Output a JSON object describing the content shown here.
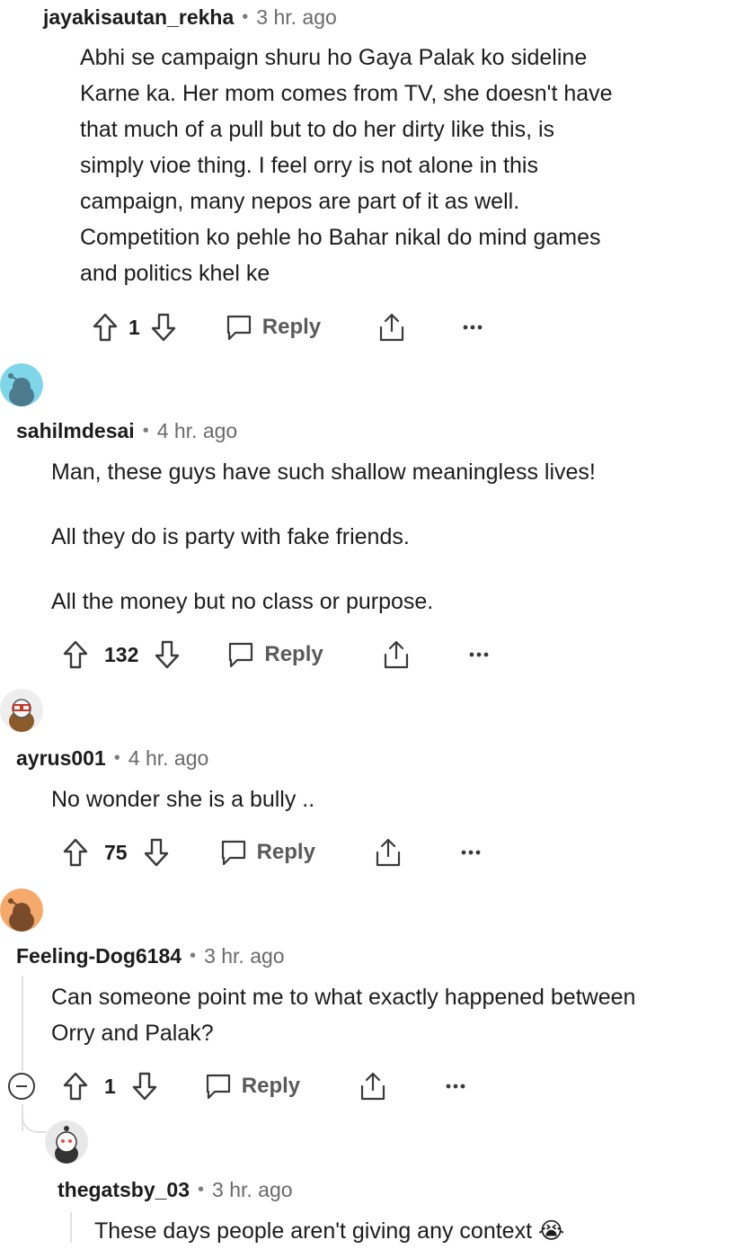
{
  "colors": {
    "text": "#1c1c1c",
    "meta": "#6a6a6a",
    "icon": "#3a3a3a",
    "thread": "#e1e1e1"
  },
  "comments": [
    {
      "user": "jayakisautan_rekha",
      "dot": "•",
      "time": "3 hr. ago",
      "body": [
        "Abhi se campaign shuru ho Gaya Palak ko sideline",
        "Karne ka. Her mom comes from TV, she doesn't have",
        "that much of a pull but to do her dirty like this, is",
        "simply vioe thing. I feel orry is not alone in this",
        "campaign, many nepos are part of it as well.",
        "Competition ko pehle ho Bahar nikal do mind games",
        "and politics khel ke"
      ],
      "votes": "1",
      "reply": "Reply"
    },
    {
      "user": "sahilmdesai",
      "dot": "•",
      "time": "4 hr. ago",
      "avatar_color": "#7fd6e8",
      "body": [
        "Man, these guys have such shallow meaningless lives!",
        "All they do is party with fake friends.",
        "All the money but no class or purpose."
      ],
      "votes": "132",
      "reply": "Reply"
    },
    {
      "user": "ayrus001",
      "dot": "•",
      "time": "4 hr. ago",
      "avatar_color": "#eeeeee",
      "body": [
        "No wonder she is a bully .."
      ],
      "votes": "75",
      "reply": "Reply"
    },
    {
      "user": "Feeling-Dog6184",
      "dot": "•",
      "time": "3 hr. ago",
      "avatar_color": "#f5a96a",
      "body": [
        "Can someone point me to what exactly happened between",
        "Orry and Palak?"
      ],
      "votes": "1",
      "reply": "Reply"
    },
    {
      "user": "thegatsby_03",
      "dot": "•",
      "time": "3 hr. ago",
      "avatar_color": "#e8e8e8",
      "body": [
        "These days people aren't giving any context 😭"
      ]
    }
  ],
  "icons": {
    "upvote": "upvote-icon",
    "downvote": "downvote-icon",
    "reply": "reply-bubble-icon",
    "share": "share-icon",
    "more": "more-options-icon",
    "collapse": "collapse-icon"
  }
}
